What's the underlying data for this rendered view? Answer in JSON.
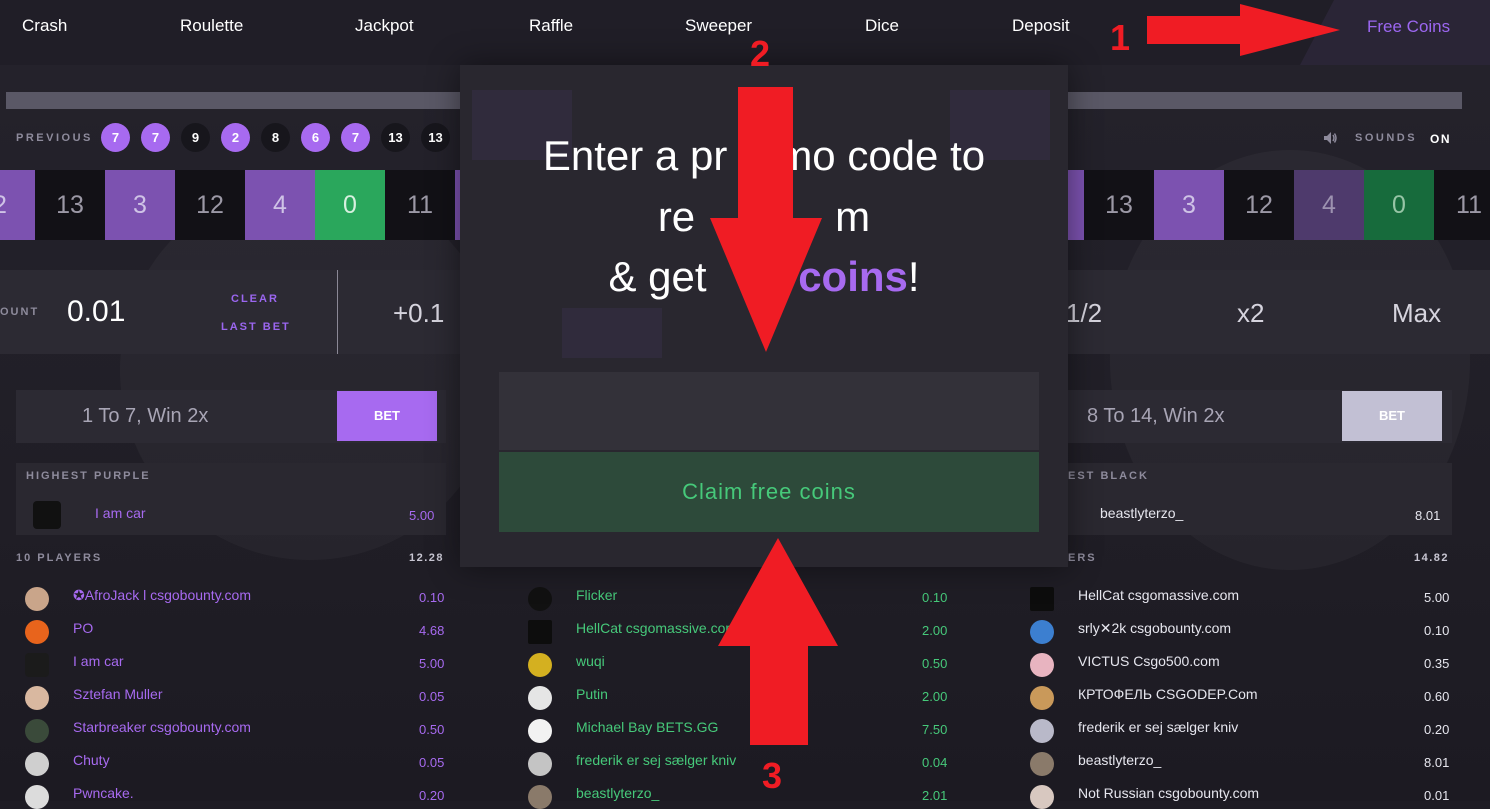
{
  "nav": {
    "items": [
      "Crash",
      "Roulette",
      "Jackpot",
      "Raffle",
      "Sweeper",
      "Dice",
      "Deposit"
    ],
    "free_coins": "Free Coins"
  },
  "previous": {
    "label": "PREVIOUS",
    "balls": [
      {
        "value": "7",
        "color": "purple"
      },
      {
        "value": "7",
        "color": "purple"
      },
      {
        "value": "9",
        "color": "black"
      },
      {
        "value": "2",
        "color": "purple"
      },
      {
        "value": "8",
        "color": "black"
      },
      {
        "value": "6",
        "color": "purple"
      },
      {
        "value": "7",
        "color": "purple"
      },
      {
        "value": "13",
        "color": "black"
      },
      {
        "value": "13",
        "color": "black"
      }
    ]
  },
  "sounds": {
    "icon": "speaker-icon",
    "label": "SOUNDS",
    "state": "ON"
  },
  "strip_left": [
    {
      "value": "2",
      "color": "purple"
    },
    {
      "value": "13",
      "color": "black"
    },
    {
      "value": "3",
      "color": "purple"
    },
    {
      "value": "12",
      "color": "black"
    },
    {
      "value": "4",
      "color": "purple"
    },
    {
      "value": "0",
      "color": "green"
    },
    {
      "value": "11",
      "color": "black"
    }
  ],
  "strip_right": [
    {
      "value": "13",
      "color": "black"
    },
    {
      "value": "3",
      "color": "purple"
    },
    {
      "value": "12",
      "color": "black"
    },
    {
      "value": "4",
      "color": "purple"
    },
    {
      "value": "0",
      "color": "green"
    },
    {
      "value": "11",
      "color": "black"
    }
  ],
  "amount": {
    "label": "OUNT",
    "value": "0.01",
    "clear": "CLEAR",
    "last_bet": "LAST BET",
    "plus": "+0.1",
    "half": "1/2",
    "double": "x2",
    "max": "Max"
  },
  "bets": {
    "left_label": "1 To 7, Win 2x",
    "right_label": "8 To 14, Win 2x",
    "button": "BET"
  },
  "highest_left": {
    "label": "HIGHEST PURPLE",
    "name": "I am car",
    "amount": "5.00"
  },
  "highest_right": {
    "label": "EST BLACK",
    "name": "beastlyterzo_",
    "amount": "8.01"
  },
  "players_left": {
    "label": "10 PLAYERS",
    "total": "12.28",
    "rows": [
      {
        "name": "✪AfroJack l csgobounty.com",
        "amount": "0.10"
      },
      {
        "name": "PO",
        "amount": "4.68"
      },
      {
        "name": "I am car",
        "amount": "5.00"
      },
      {
        "name": "Sztefan Muller",
        "amount": "0.05"
      },
      {
        "name": "Starbreaker csgobounty.com",
        "amount": "0.50"
      },
      {
        "name": "Chuty",
        "amount": "0.05"
      },
      {
        "name": "Pwncake.",
        "amount": "0.20"
      }
    ]
  },
  "players_mid": {
    "rows": [
      {
        "name": "Flicker",
        "amount": "0.10"
      },
      {
        "name": "HellCat csgomassive.com",
        "amount": "2.00"
      },
      {
        "name": "wuqi",
        "amount": "0.50"
      },
      {
        "name": "Putin",
        "amount": "2.00"
      },
      {
        "name": "Michael Bay BETS.GG",
        "amount": "7.50"
      },
      {
        "name": "frederik er sej sælger kniv",
        "amount": "0.04"
      },
      {
        "name": "beastlyterzo_",
        "amount": "2.01"
      }
    ]
  },
  "players_right": {
    "label": "ERS",
    "total": "14.82",
    "rows": [
      {
        "name": "HellCat csgomassive.com",
        "amount": "5.00"
      },
      {
        "name": "srly✕2k csgobounty.com",
        "amount": "0.10"
      },
      {
        "name": "VICTUS Csgo500.com",
        "amount": "0.35"
      },
      {
        "name": "КРТОФЕЛЬ CSGODEP.Com",
        "amount": "0.60"
      },
      {
        "name": "frederik er sej sælger kniv",
        "amount": "0.20"
      },
      {
        "name": "beastlyterzo_",
        "amount": "8.01"
      },
      {
        "name": "Not Russian csgobounty.com",
        "amount": "0.01"
      }
    ]
  },
  "modal": {
    "line1": "Enter a pr",
    "line1b": "mo code to",
    "line2a": "re",
    "line2b": "m",
    "line3a": "& get ",
    "line3b": "coins",
    "line3c": "!",
    "promo_placeholder": "",
    "claim": "Claim free coins"
  },
  "annotations": [
    "1",
    "2",
    "3"
  ],
  "colors": {
    "purple": "#a76af0",
    "green": "#2aa75c",
    "arrow_red": "#f01c24"
  }
}
